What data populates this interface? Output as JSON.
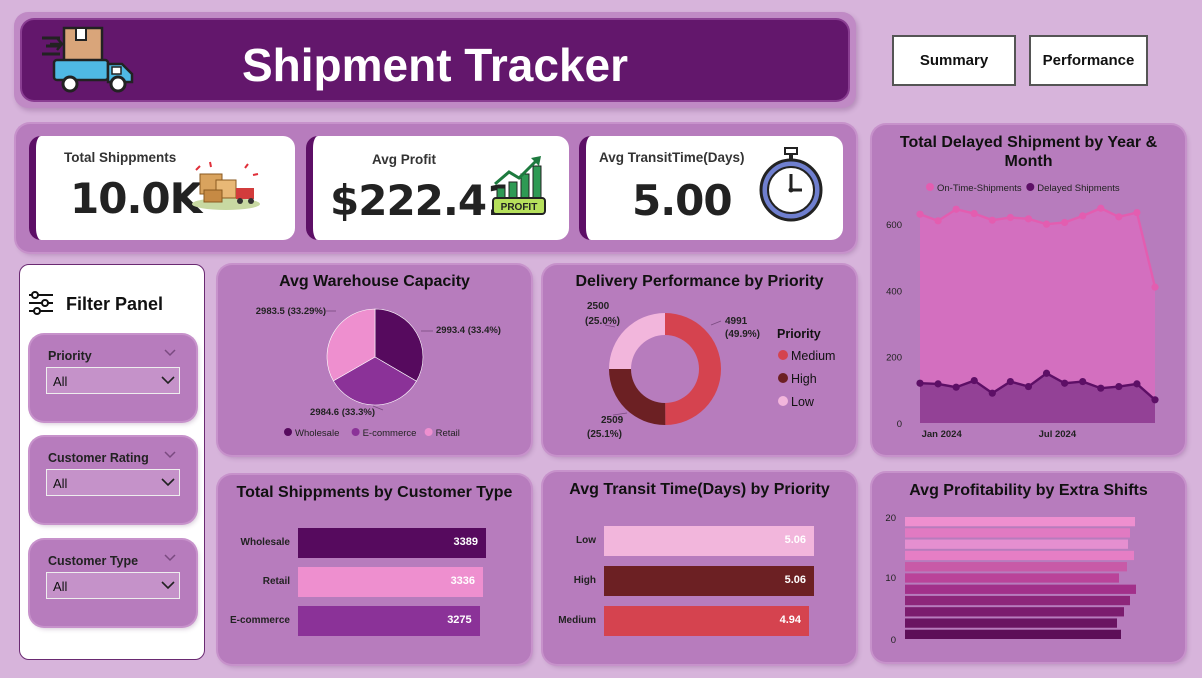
{
  "header": {
    "title": "Shipment Tracker",
    "icon": "delivery-truck-icon"
  },
  "nav": {
    "summary_label": "Summary",
    "performance_label": "Performance"
  },
  "kpis": [
    {
      "label": "Total Shippments",
      "value": "10.0K",
      "icon": "packages-icon"
    },
    {
      "label": "Avg Profit",
      "value": "$222.41",
      "icon": "profit-chart-icon",
      "icon_text": "PROFIT"
    },
    {
      "label": "Avg TransitTime(Days)",
      "value": "5.00",
      "icon": "stopwatch-icon"
    }
  ],
  "filter_panel": {
    "title": "Filter Panel",
    "slicers": [
      {
        "label": "Priority",
        "value": "All"
      },
      {
        "label": "Customer Rating",
        "value": "All"
      },
      {
        "label": "Customer Type",
        "value": "All"
      }
    ]
  },
  "colors": {
    "background": "#d7b4db",
    "panel": "#b77cbd",
    "header": "#63176c",
    "dark_purple": "#560a5e",
    "mid_purple": "#8b3298",
    "pink": "#ee8fcf",
    "red": "#d5434f",
    "maroon": "#6c2023",
    "light_pink": "#f2b6dc"
  },
  "chart_data": [
    {
      "type": "pie",
      "title": "Avg Warehouse Capacity",
      "categories": [
        "Wholesale",
        "E-commerce",
        "Retail"
      ],
      "values": [
        2993.4,
        2984.6,
        2983.5
      ],
      "labels": [
        "2993.4 (33.4%)",
        "2984.6 (33.3%)",
        "2983.5 (33.29%)"
      ],
      "legend_position": "bottom",
      "colors": [
        "#560a5e",
        "#8b3298",
        "#ee8fcf"
      ]
    },
    {
      "type": "pie",
      "subtype": "donut",
      "title": "Delivery Performance by Priority",
      "legend_title": "Priority",
      "categories": [
        "Medium",
        "High",
        "Low"
      ],
      "values": [
        4991,
        2509,
        2500
      ],
      "label_values": [
        "4991",
        "2509",
        "2500"
      ],
      "label_pcts": [
        "(49.9%)",
        "(25.1%)",
        "(25.0%)"
      ],
      "legend_position": "right",
      "colors": [
        "#d5434f",
        "#6c2023",
        "#f2b6dc"
      ]
    },
    {
      "type": "bar",
      "orientation": "horizontal",
      "title": "Total Shippments by Customer Type",
      "categories": [
        "Wholesale",
        "Retail",
        "E-commerce"
      ],
      "values": [
        3389,
        3336,
        3275
      ],
      "colors": [
        "#560a5e",
        "#ee8fcf",
        "#8b3298"
      ]
    },
    {
      "type": "bar",
      "orientation": "horizontal",
      "title": "Avg Transit Time(Days) by Priority",
      "categories": [
        "Low",
        "High",
        "Medium"
      ],
      "values": [
        5.06,
        5.06,
        4.94
      ],
      "value_labels": [
        "5.06",
        "5.06",
        "4.94"
      ],
      "colors": [
        "#f2b6dc",
        "#6c2023",
        "#d5434f"
      ]
    },
    {
      "type": "area",
      "title": "Total Delayed Shipment by Year & Month",
      "legend_position": "top",
      "x_tick_labels": [
        "Jan 2024",
        "Jul 2024"
      ],
      "y_ticks": [
        "0",
        "200",
        "400",
        "600"
      ],
      "ylim": [
        0,
        700
      ],
      "grid": false,
      "series": [
        {
          "name": "On-Time-Shipments",
          "color": "#e35db0",
          "values": [
            630,
            610,
            645,
            632,
            612,
            620,
            616,
            600,
            605,
            625,
            648,
            622,
            635,
            410
          ]
        },
        {
          "name": "Delayed Shipments",
          "color": "#5d0f66",
          "values": [
            120,
            118,
            108,
            128,
            90,
            125,
            110,
            150,
            120,
            125,
            105,
            110,
            118,
            70
          ]
        }
      ]
    },
    {
      "type": "bar",
      "orientation": "horizontal",
      "title": "Avg Profitability by Extra Shifts",
      "y_ticks": [
        "0",
        "10",
        "20"
      ],
      "ylim": [
        0,
        20
      ],
      "xlim": [
        0,
        240
      ],
      "categories": [
        "20",
        "18",
        "16",
        "14",
        "12",
        "10",
        "8",
        "6",
        "4",
        "2",
        "0"
      ],
      "values": [
        230,
        225,
        223,
        229,
        222,
        214,
        231,
        225,
        219,
        212,
        216
      ],
      "colors": [
        "#ee8fcf",
        "#e17ac2",
        "#e58fd0",
        "#e67ec5",
        "#c85aa7",
        "#ba4399",
        "#a2308a",
        "#8d267a",
        "#7b1c6e",
        "#6a1462",
        "#5d0f58"
      ]
    }
  ]
}
